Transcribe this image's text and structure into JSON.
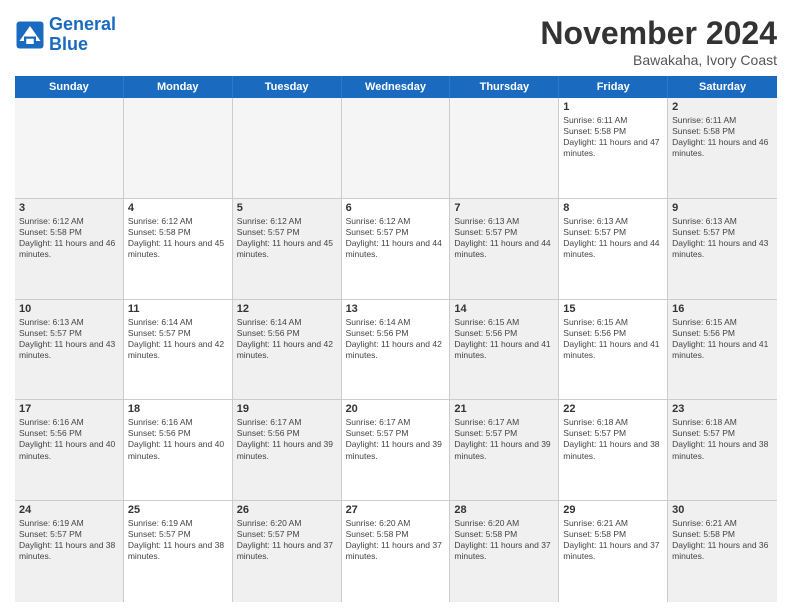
{
  "logo": {
    "line1": "General",
    "line2": "Blue"
  },
  "title": "November 2024",
  "location": "Bawakaha, Ivory Coast",
  "weekdays": [
    "Sunday",
    "Monday",
    "Tuesday",
    "Wednesday",
    "Thursday",
    "Friday",
    "Saturday"
  ],
  "weeks": [
    [
      {
        "day": "",
        "info": "",
        "empty": true
      },
      {
        "day": "",
        "info": "",
        "empty": true
      },
      {
        "day": "",
        "info": "",
        "empty": true
      },
      {
        "day": "",
        "info": "",
        "empty": true
      },
      {
        "day": "",
        "info": "",
        "empty": true
      },
      {
        "day": "1",
        "info": "Sunrise: 6:11 AM\nSunset: 5:58 PM\nDaylight: 11 hours and 47 minutes.",
        "empty": false
      },
      {
        "day": "2",
        "info": "Sunrise: 6:11 AM\nSunset: 5:58 PM\nDaylight: 11 hours and 46 minutes.",
        "empty": false,
        "shaded": true
      }
    ],
    [
      {
        "day": "3",
        "info": "Sunrise: 6:12 AM\nSunset: 5:58 PM\nDaylight: 11 hours and 46 minutes.",
        "empty": false,
        "shaded": true
      },
      {
        "day": "4",
        "info": "Sunrise: 6:12 AM\nSunset: 5:58 PM\nDaylight: 11 hours and 45 minutes.",
        "empty": false
      },
      {
        "day": "5",
        "info": "Sunrise: 6:12 AM\nSunset: 5:57 PM\nDaylight: 11 hours and 45 minutes.",
        "empty": false,
        "shaded": true
      },
      {
        "day": "6",
        "info": "Sunrise: 6:12 AM\nSunset: 5:57 PM\nDaylight: 11 hours and 44 minutes.",
        "empty": false
      },
      {
        "day": "7",
        "info": "Sunrise: 6:13 AM\nSunset: 5:57 PM\nDaylight: 11 hours and 44 minutes.",
        "empty": false,
        "shaded": true
      },
      {
        "day": "8",
        "info": "Sunrise: 6:13 AM\nSunset: 5:57 PM\nDaylight: 11 hours and 44 minutes.",
        "empty": false
      },
      {
        "day": "9",
        "info": "Sunrise: 6:13 AM\nSunset: 5:57 PM\nDaylight: 11 hours and 43 minutes.",
        "empty": false,
        "shaded": true
      }
    ],
    [
      {
        "day": "10",
        "info": "Sunrise: 6:13 AM\nSunset: 5:57 PM\nDaylight: 11 hours and 43 minutes.",
        "empty": false,
        "shaded": true
      },
      {
        "day": "11",
        "info": "Sunrise: 6:14 AM\nSunset: 5:57 PM\nDaylight: 11 hours and 42 minutes.",
        "empty": false
      },
      {
        "day": "12",
        "info": "Sunrise: 6:14 AM\nSunset: 5:56 PM\nDaylight: 11 hours and 42 minutes.",
        "empty": false,
        "shaded": true
      },
      {
        "day": "13",
        "info": "Sunrise: 6:14 AM\nSunset: 5:56 PM\nDaylight: 11 hours and 42 minutes.",
        "empty": false
      },
      {
        "day": "14",
        "info": "Sunrise: 6:15 AM\nSunset: 5:56 PM\nDaylight: 11 hours and 41 minutes.",
        "empty": false,
        "shaded": true
      },
      {
        "day": "15",
        "info": "Sunrise: 6:15 AM\nSunset: 5:56 PM\nDaylight: 11 hours and 41 minutes.",
        "empty": false
      },
      {
        "day": "16",
        "info": "Sunrise: 6:15 AM\nSunset: 5:56 PM\nDaylight: 11 hours and 41 minutes.",
        "empty": false,
        "shaded": true
      }
    ],
    [
      {
        "day": "17",
        "info": "Sunrise: 6:16 AM\nSunset: 5:56 PM\nDaylight: 11 hours and 40 minutes.",
        "empty": false,
        "shaded": true
      },
      {
        "day": "18",
        "info": "Sunrise: 6:16 AM\nSunset: 5:56 PM\nDaylight: 11 hours and 40 minutes.",
        "empty": false
      },
      {
        "day": "19",
        "info": "Sunrise: 6:17 AM\nSunset: 5:56 PM\nDaylight: 11 hours and 39 minutes.",
        "empty": false,
        "shaded": true
      },
      {
        "day": "20",
        "info": "Sunrise: 6:17 AM\nSunset: 5:57 PM\nDaylight: 11 hours and 39 minutes.",
        "empty": false
      },
      {
        "day": "21",
        "info": "Sunrise: 6:17 AM\nSunset: 5:57 PM\nDaylight: 11 hours and 39 minutes.",
        "empty": false,
        "shaded": true
      },
      {
        "day": "22",
        "info": "Sunrise: 6:18 AM\nSunset: 5:57 PM\nDaylight: 11 hours and 38 minutes.",
        "empty": false
      },
      {
        "day": "23",
        "info": "Sunrise: 6:18 AM\nSunset: 5:57 PM\nDaylight: 11 hours and 38 minutes.",
        "empty": false,
        "shaded": true
      }
    ],
    [
      {
        "day": "24",
        "info": "Sunrise: 6:19 AM\nSunset: 5:57 PM\nDaylight: 11 hours and 38 minutes.",
        "empty": false,
        "shaded": true
      },
      {
        "day": "25",
        "info": "Sunrise: 6:19 AM\nSunset: 5:57 PM\nDaylight: 11 hours and 38 minutes.",
        "empty": false
      },
      {
        "day": "26",
        "info": "Sunrise: 6:20 AM\nSunset: 5:57 PM\nDaylight: 11 hours and 37 minutes.",
        "empty": false,
        "shaded": true
      },
      {
        "day": "27",
        "info": "Sunrise: 6:20 AM\nSunset: 5:58 PM\nDaylight: 11 hours and 37 minutes.",
        "empty": false
      },
      {
        "day": "28",
        "info": "Sunrise: 6:20 AM\nSunset: 5:58 PM\nDaylight: 11 hours and 37 minutes.",
        "empty": false,
        "shaded": true
      },
      {
        "day": "29",
        "info": "Sunrise: 6:21 AM\nSunset: 5:58 PM\nDaylight: 11 hours and 37 minutes.",
        "empty": false
      },
      {
        "day": "30",
        "info": "Sunrise: 6:21 AM\nSunset: 5:58 PM\nDaylight: 11 hours and 36 minutes.",
        "empty": false,
        "shaded": true
      }
    ]
  ]
}
